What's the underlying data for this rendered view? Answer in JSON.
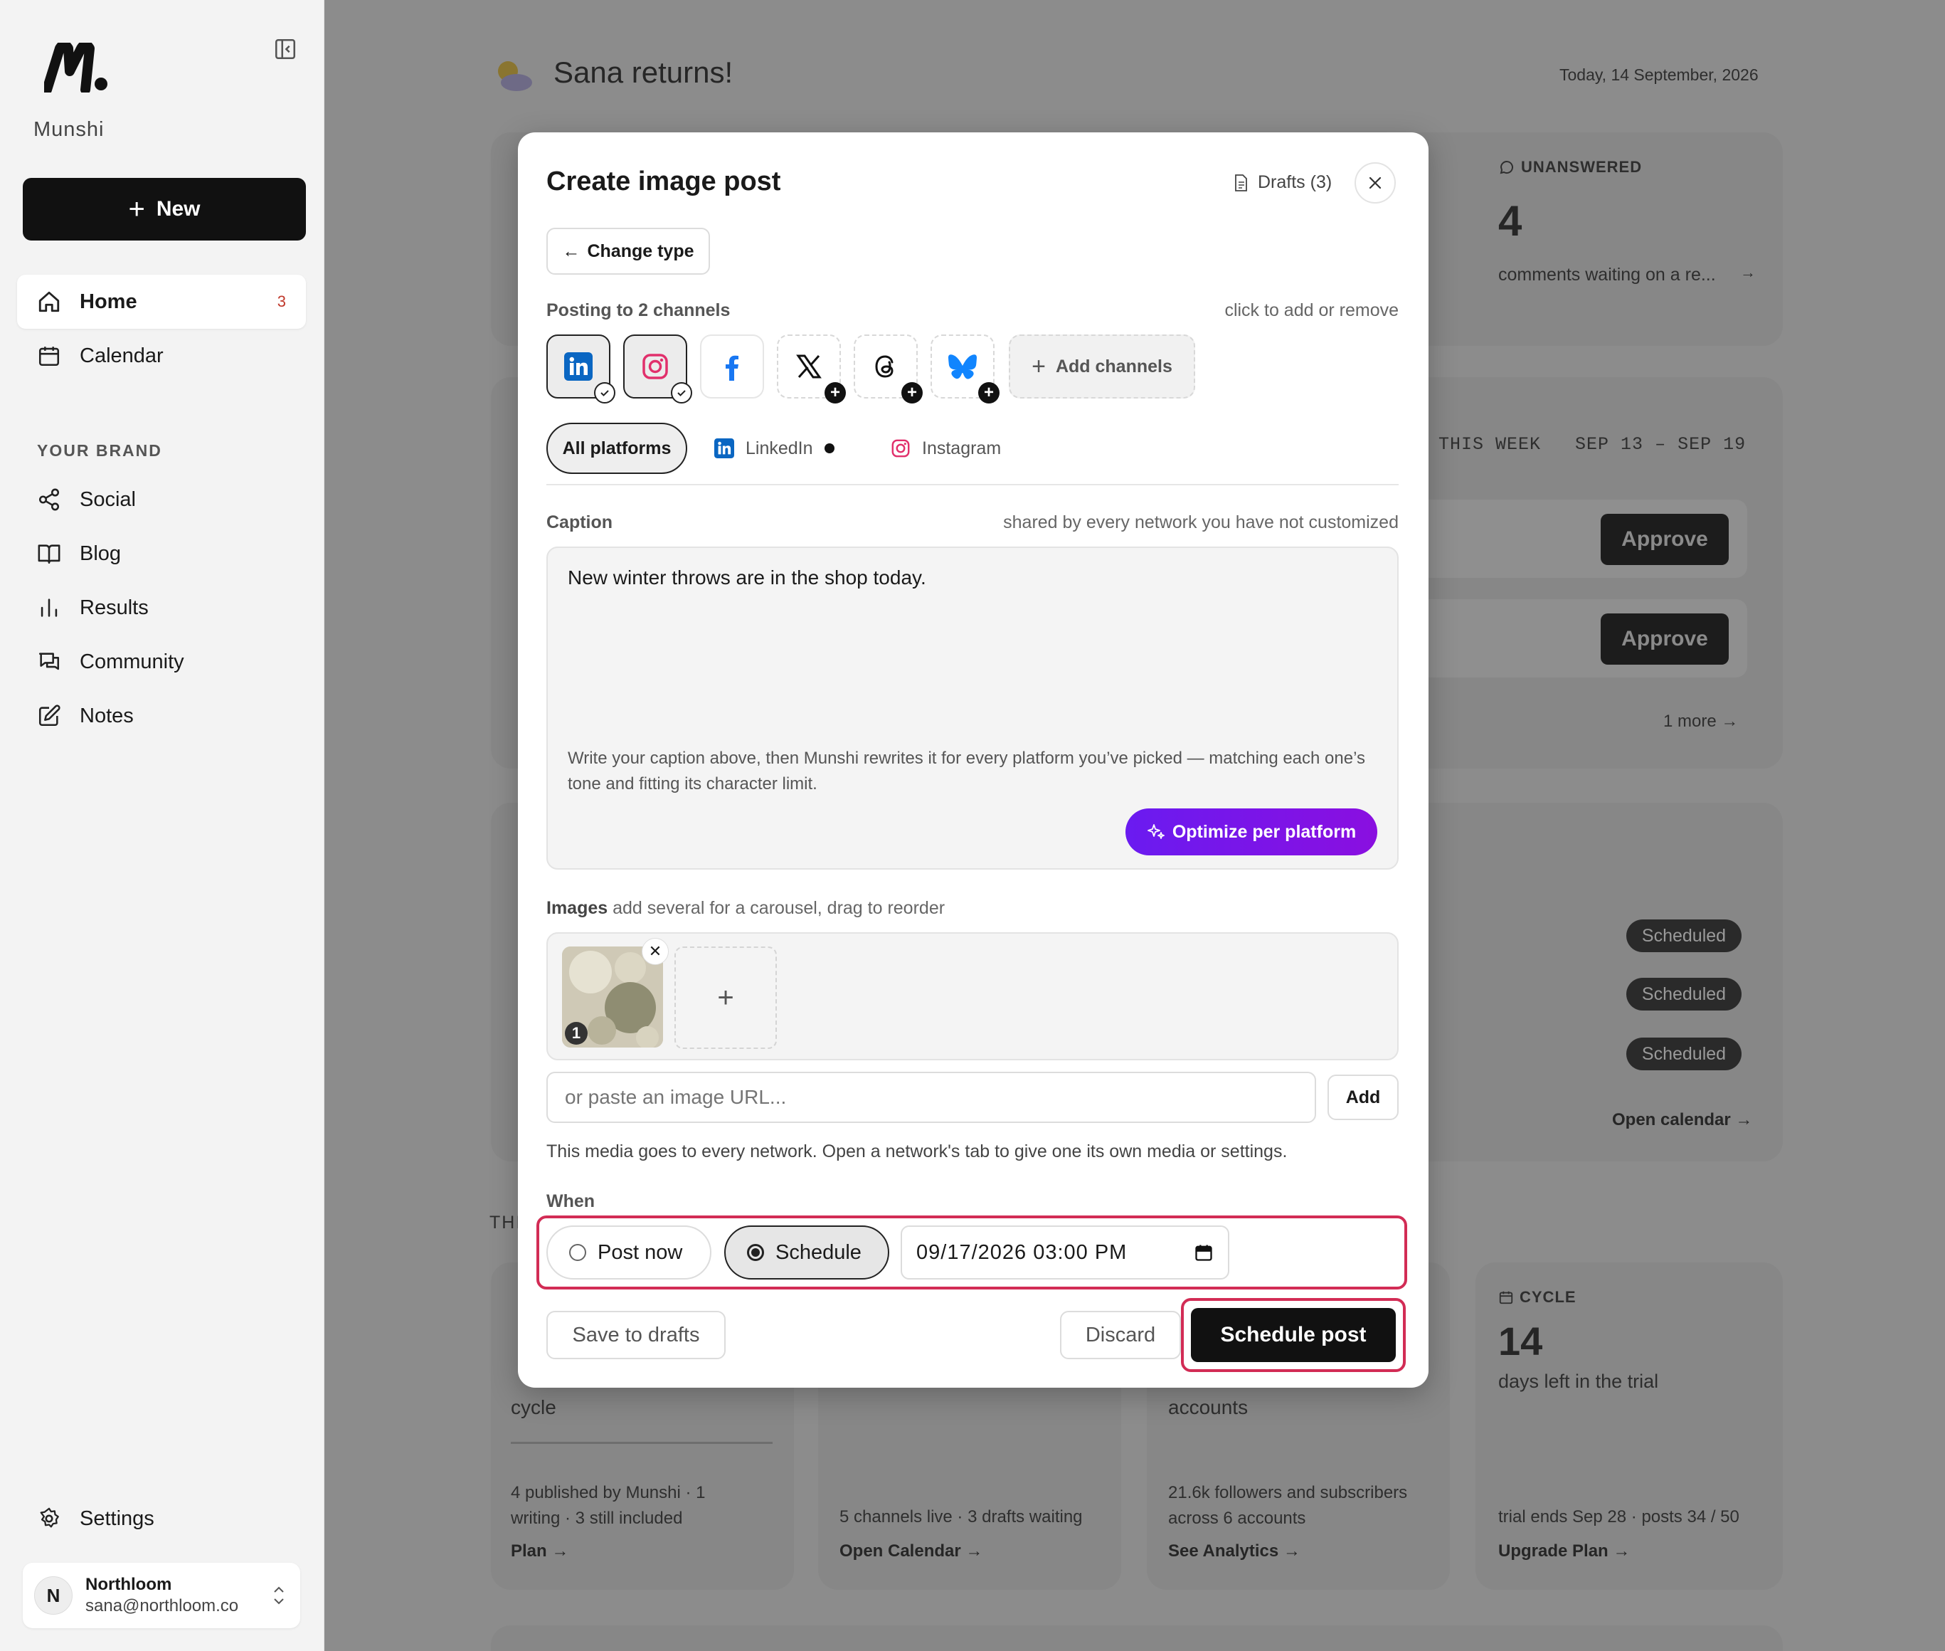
{
  "sidebar": {
    "brand": "Munshi",
    "new_label": "New",
    "nav": [
      {
        "label": "Home",
        "badge": "3"
      },
      {
        "label": "Calendar"
      }
    ],
    "section_label": "YOUR BRAND",
    "brand_nav": [
      {
        "label": "Social"
      },
      {
        "label": "Blog"
      },
      {
        "label": "Results"
      },
      {
        "label": "Community"
      },
      {
        "label": "Notes"
      }
    ],
    "settings_label": "Settings",
    "account": {
      "initial": "N",
      "name": "Northloom",
      "email": "sana@northloom.co"
    }
  },
  "background": {
    "greeting": "Sana returns!",
    "date": "Today, 14 September, 2026",
    "unanswered": {
      "label": "UNANSWERED",
      "value": "4",
      "desc": "comments waiting on a re..."
    },
    "week": {
      "label": "THIS WEEK",
      "range": "SEP 13 – SEP 19"
    },
    "approve_label": "Approve",
    "more_label": "1 more",
    "scheduled_label": "Scheduled",
    "open_calendar": "Open calendar →",
    "cards": [
      {
        "text": "cycle",
        "foot": "4 published by Munshi · 1 writing · 3 still included",
        "link": "Plan →"
      },
      {
        "foot": "5 channels live · 3 drafts waiting",
        "link": "Open Calendar →"
      },
      {
        "text": "accounts",
        "foot": "21.6k followers and subscribers across 6 accounts",
        "link": "See Analytics →"
      },
      {
        "label": "CYCLE",
        "value": "14",
        "text": "days left in the trial",
        "foot": "trial ends Sep 28 · posts 34 / 50",
        "link": "Upgrade Plan →"
      }
    ]
  },
  "modal": {
    "title": "Create image post",
    "drafts_label": "Drafts (3)",
    "change_type": "Change type",
    "posting_label": "Posting to 2 channels",
    "click_hint": "click to add or remove",
    "channels": [
      {
        "name": "LinkedIn",
        "selected": true,
        "color": "#0a66c2"
      },
      {
        "name": "Instagram",
        "selected": true,
        "color": "#e1306c"
      },
      {
        "name": "Facebook",
        "selected": false,
        "color": "#1877f2"
      },
      {
        "name": "X",
        "selected": false,
        "color": "#111111"
      },
      {
        "name": "Threads",
        "selected": false,
        "color": "#111111"
      },
      {
        "name": "Bluesky",
        "selected": false,
        "color": "#1185fe"
      }
    ],
    "add_channels": "Add channels",
    "tabs": {
      "all": "All platforms",
      "linkedin": "LinkedIn",
      "instagram": "Instagram"
    },
    "caption_label": "Caption",
    "caption_hint": "shared by every network you have not customized",
    "caption_text": "New winter throws are in the shop today.",
    "caption_help": "Write your caption above, then Munshi rewrites it for every platform you’ve picked — matching each one’s tone and fitting its character limit.",
    "optimize_label": "Optimize per platform",
    "images_label": "Images",
    "images_hint": "add several for a carousel, drag to reorder",
    "image_index": "1",
    "url_placeholder": "or paste an image URL...",
    "url_add": "Add",
    "media_note": "This media goes to every network. Open a network's tab to give one its own media or settings.",
    "when_label": "When",
    "post_now": "Post now",
    "schedule": "Schedule",
    "datetime": "09/17/2026 03:00 PM",
    "save_drafts": "Save to drafts",
    "discard": "Discard",
    "schedule_post": "Schedule post"
  },
  "colors": {
    "accent": "#7b16e8",
    "highlight": "#d22c55"
  }
}
